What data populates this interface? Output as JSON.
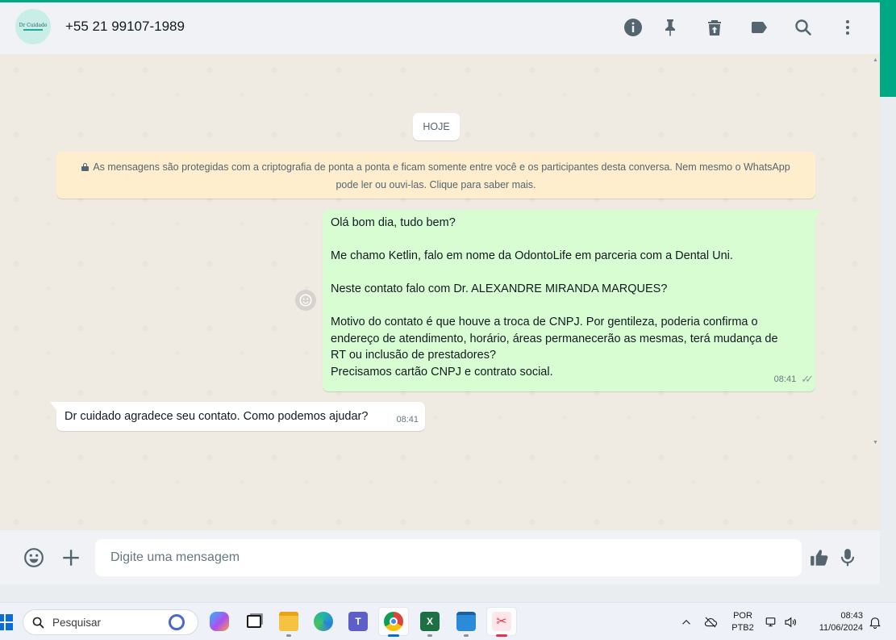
{
  "app": {
    "accent_color": "#00a884"
  },
  "header": {
    "avatar_logo_text": "Dr Cuidado",
    "contact_name": "+55 21 99107-1989",
    "icons": [
      "info-icon",
      "pin-icon",
      "delete-chat-icon",
      "label-icon",
      "search-icon",
      "menu-icon"
    ]
  },
  "chat": {
    "date_label": "HOJE",
    "encryption_notice": "As mensagens são protegidas com a criptografia de ponta a ponta e ficam somente entre você e os participantes desta conversa. Nem mesmo o WhatsApp pode ler ou ouvi-las. Clique para saber mais.",
    "messages": [
      {
        "direction": "outgoing",
        "lines": [
          "Olá bom dia, tudo bem?",
          "",
          "Me chamo Ketlin, falo em nome da OdontoLife em parceria com a Dental Uni.",
          "",
          "Neste contato falo com Dr. ALEXANDRE MIRANDA MARQUES?",
          "",
          "Motivo do contato é que houve a troca de CNPJ. Por gentileza, poderia confirma o",
          "endereço de atendimento, horário, áreas permanecerão as mesmas, terá mudança de",
          "RT ou inclusão de prestadores?",
          "Precisamos cartão CNPJ e contrato social."
        ],
        "time": "08:41",
        "status": "read",
        "bubble_color": "#d9fdd3"
      },
      {
        "direction": "incoming",
        "text": "Dr cuidado agradece seu contato. Como podemos ajudar?",
        "time": "08:41",
        "bubble_color": "#ffffff"
      }
    ]
  },
  "composer": {
    "placeholder": "Digite uma mensagem",
    "icons": [
      "emoji-icon",
      "attach-plus-icon",
      "thumbs-up-icon",
      "microphone-icon"
    ]
  },
  "taskbar": {
    "search_placeholder": "Pesquisar",
    "apps": [
      "copilot-icon",
      "task-view-icon",
      "file-explorer-icon",
      "edge-icon",
      "teams-icon",
      "chrome-icon",
      "excel-icon",
      "notepad-icon",
      "snipping-tool-icon"
    ],
    "active_app": "chrome-icon",
    "language_line1": "POR",
    "language_line2": "PTB2",
    "time": "08:43",
    "date": "11/06/2024"
  }
}
